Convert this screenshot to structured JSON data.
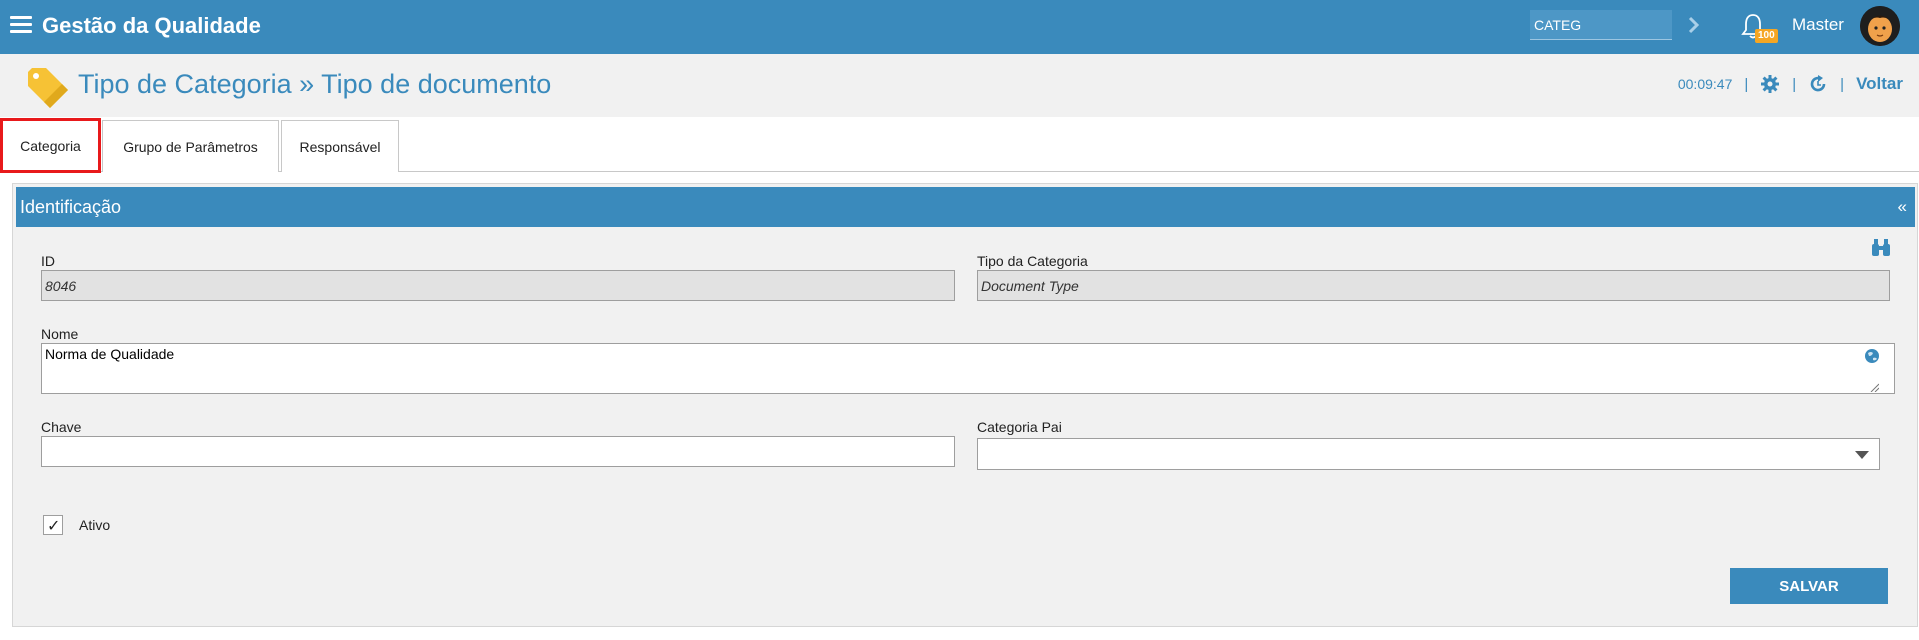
{
  "app": {
    "title": "Gestão da Qualidade"
  },
  "topbar": {
    "search_value": "CATEG",
    "notification_count": "100",
    "user_name": "Master"
  },
  "header": {
    "title": "Tipo de Categoria » Tipo de documento",
    "timer": "00:09:47",
    "back_label": "Voltar"
  },
  "tabs": [
    {
      "label": "Categoria",
      "active": true
    },
    {
      "label": "Grupo de Parâmetros",
      "active": false
    },
    {
      "label": "Responsável",
      "active": false
    }
  ],
  "section": {
    "title": "Identificação",
    "collapse_glyph": "«"
  },
  "form": {
    "id_label": "ID",
    "id_value": "8046",
    "tipo_label": "Tipo da Categoria",
    "tipo_value": "Document Type",
    "nome_label": "Nome",
    "nome_value": "Norma de Qualidade",
    "chave_label": "Chave",
    "chave_value": "",
    "pai_label": "Categoria Pai",
    "pai_value": "",
    "ativo_label": "Ativo",
    "ativo_checked": true,
    "ativo_mark": "✓",
    "save_label": "SALVAR"
  },
  "colors": {
    "primary": "#3a8abc",
    "badge": "#f5a623",
    "highlight": "#e8191b"
  },
  "icons": [
    "menu-icon",
    "chevron-right-icon",
    "bell-icon",
    "avatar",
    "tag-icon",
    "gear-icon",
    "refresh-icon",
    "binoculars-icon",
    "globe-icon",
    "caret-down-icon",
    "checkmark-icon"
  ]
}
